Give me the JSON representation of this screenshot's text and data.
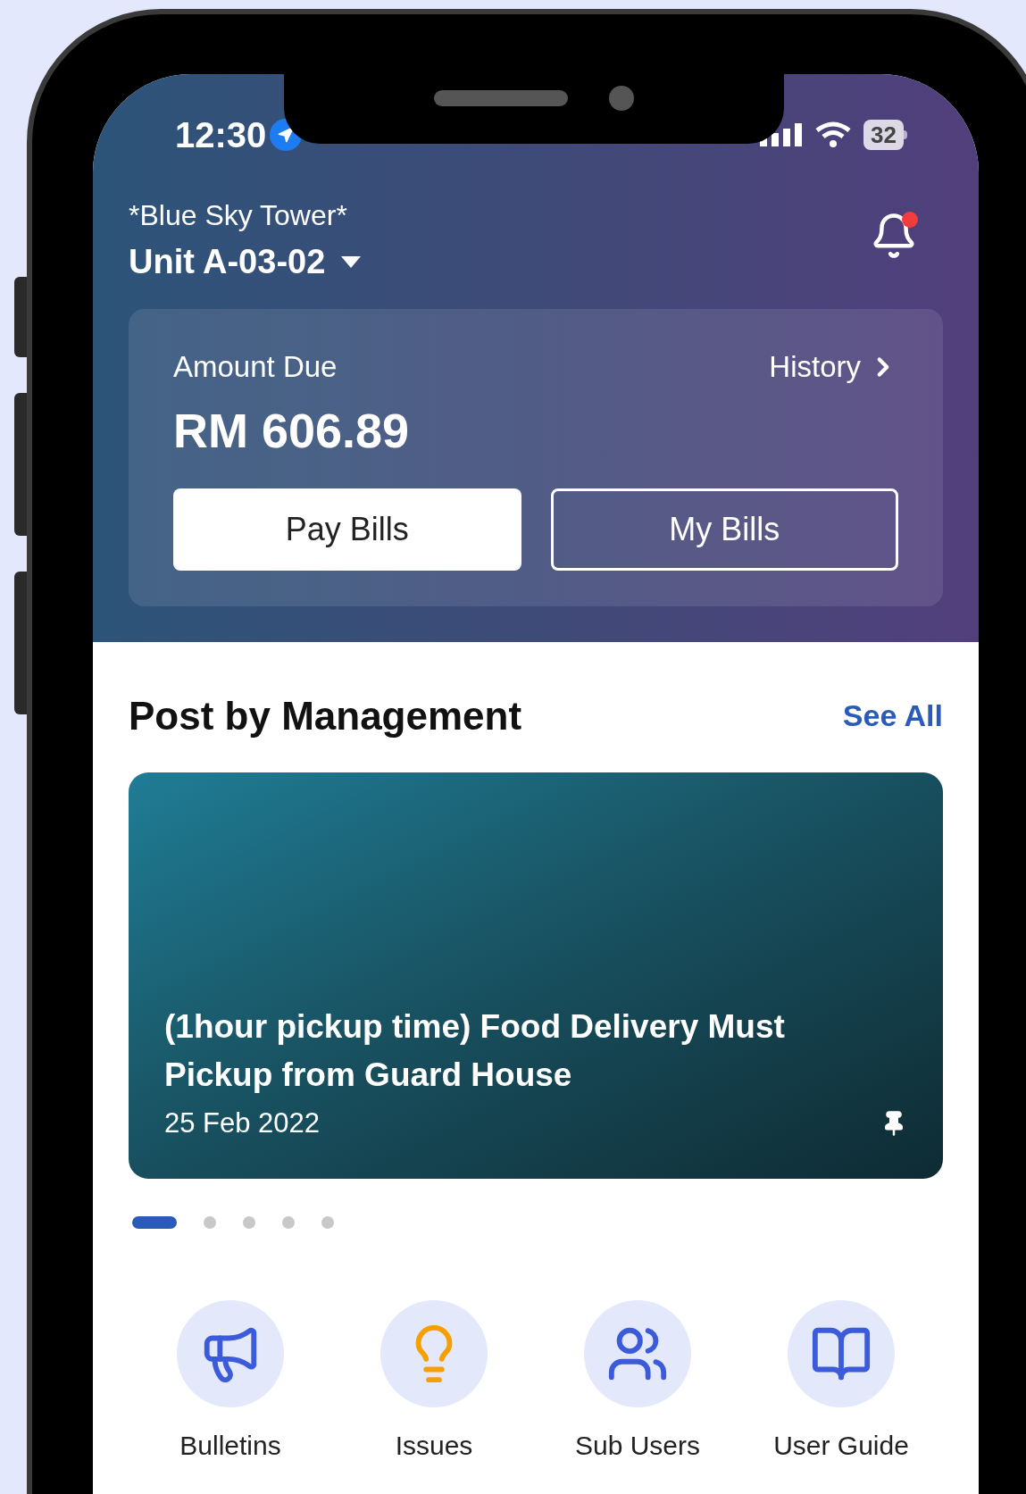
{
  "status_bar": {
    "time": "12:30",
    "battery": "32"
  },
  "header": {
    "building": "*Blue Sky Tower*",
    "unit": "Unit A-03-02",
    "has_notification": true
  },
  "bill_card": {
    "label": "Amount Due",
    "amount": "RM 606.89",
    "history_link": "History",
    "buttons": [
      {
        "label": "Pay Bills",
        "kind": "filled"
      },
      {
        "label": "My Bills",
        "kind": "outline"
      }
    ]
  },
  "posts": {
    "title": "Post by Management",
    "see_all": "See All",
    "post": {
      "title": "(1hour pickup time) Food Delivery Must Pickup from Guard House",
      "date": "25 Feb 2022",
      "pinned": true
    },
    "pager": [
      {
        "selected": true
      },
      {
        "selected": false
      },
      {
        "selected": false
      },
      {
        "selected": false
      },
      {
        "selected": false
      }
    ]
  },
  "shortcuts": [
    {
      "label": "Bulletins"
    },
    {
      "label": "Issues"
    },
    {
      "label": "Sub Users"
    },
    {
      "label": "User Guide"
    }
  ]
}
